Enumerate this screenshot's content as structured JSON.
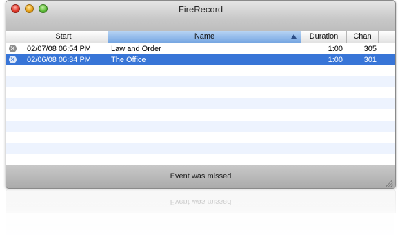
{
  "window": {
    "title": "FireRecord"
  },
  "table": {
    "columns": [
      {
        "label": ""
      },
      {
        "label": "Start"
      },
      {
        "label": "Name"
      },
      {
        "label": "Duration"
      },
      {
        "label": "Chan"
      }
    ],
    "sort": {
      "column": "Name",
      "direction": "ascending"
    },
    "rows": [
      {
        "status_icon": "missed-x-icon",
        "start": "02/07/08 06:54 PM",
        "name": "Law and Order",
        "duration": "1:00",
        "chan": "305",
        "selected": false
      },
      {
        "status_icon": "missed-x-icon",
        "start": "02/06/08 06:34 PM",
        "name": "The Office",
        "duration": "1:00",
        "chan": "301",
        "selected": true
      }
    ]
  },
  "status": {
    "text": "Event was missed"
  },
  "colors": {
    "selection": "#3875d7",
    "sorted_header": "#76a6e2",
    "stripe": "#edf3fe"
  }
}
